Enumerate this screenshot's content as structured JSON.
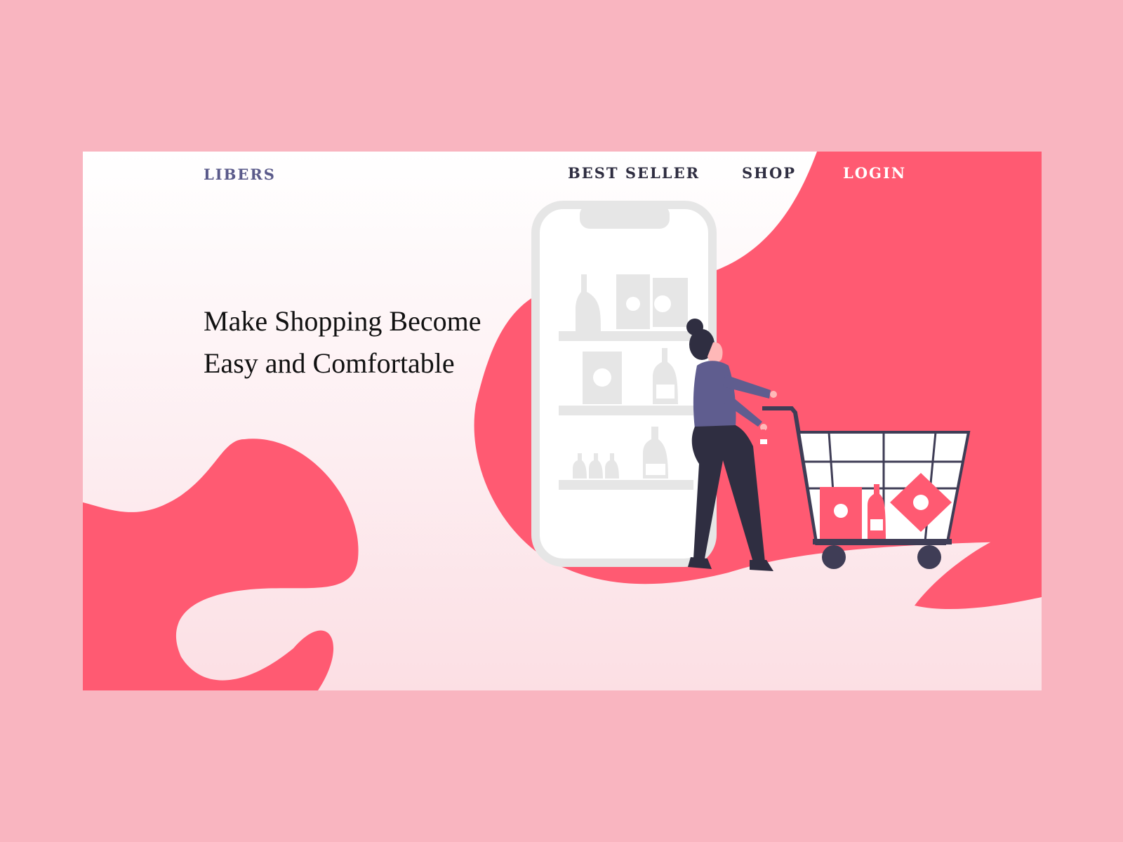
{
  "header": {
    "brand": "LIBERS",
    "nav": [
      {
        "label": "BEST SELLER"
      },
      {
        "label": "SHOP"
      },
      {
        "label": "LOGIN"
      }
    ]
  },
  "hero": {
    "title_line1": "Make Shopping Become",
    "title_line2": "Easy and Comfortable"
  },
  "colors": {
    "accent": "#ff5a72",
    "dark": "#2f2e41",
    "purple": "#5f5d8f",
    "shelf": "#e6e6e6"
  },
  "illustration": {
    "icons": [
      "phone-icon",
      "woman-icon",
      "shopping-cart-icon",
      "bottle-icon"
    ]
  }
}
